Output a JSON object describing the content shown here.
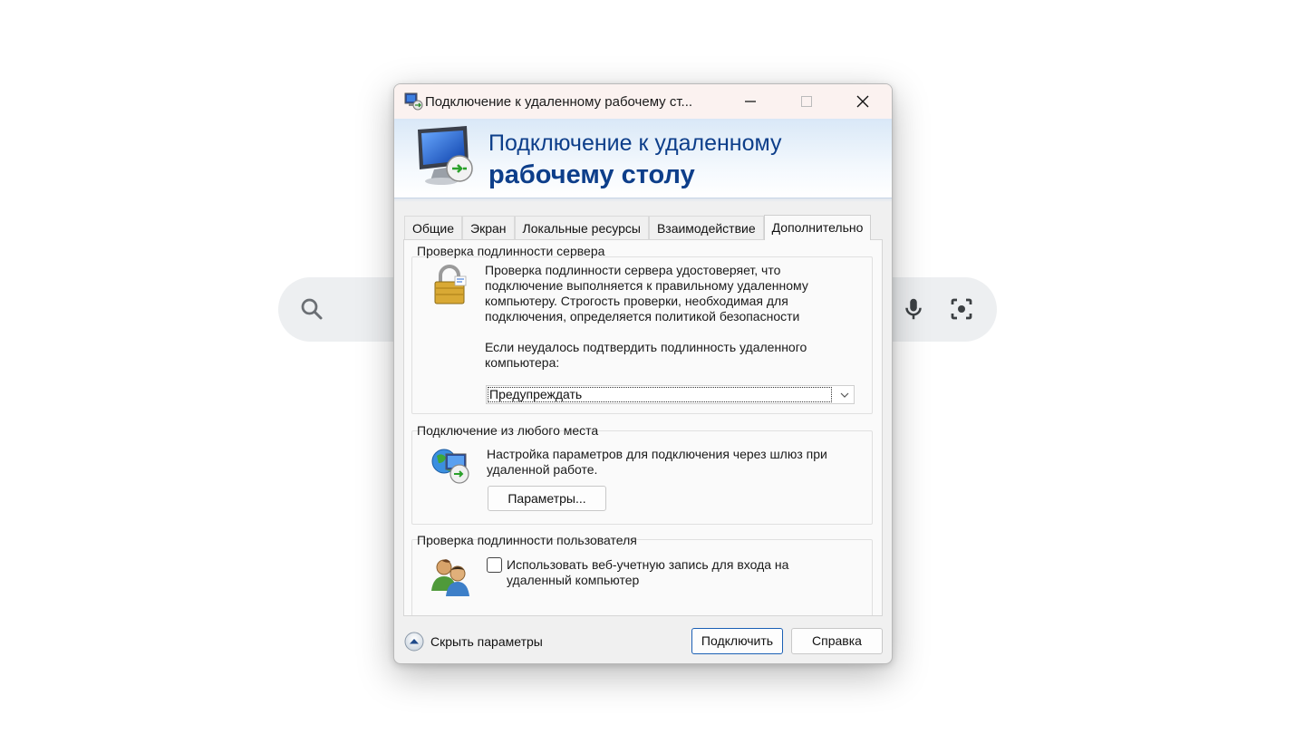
{
  "window": {
    "title": "Подключение к удаленному рабочему ст...",
    "banner_line1": "Подключение к удаленному",
    "banner_line2": "рабочему столу"
  },
  "tabs": [
    {
      "label": "Общие"
    },
    {
      "label": "Экран"
    },
    {
      "label": "Локальные ресурсы"
    },
    {
      "label": "Взаимодействие"
    },
    {
      "label": "Дополнительно",
      "active": true
    }
  ],
  "server_auth": {
    "title": "Проверка подлинности сервера",
    "description": [
      "Проверка подлинности сервера удостоверяет, что",
      "подключение выполняется к правильному удаленному",
      "компьютеру. Строгость проверки, необходимая для",
      "подключения, определяется политикой безопасности"
    ],
    "prompt": [
      "Если неудалось подтвердить подлинность удаленного",
      "компьютера:"
    ],
    "selected_option": "Предупреждать"
  },
  "gateway": {
    "title": "Подключение из любого места",
    "description": [
      "Настройка параметров для подключения через шлюз при",
      "удаленной работе."
    ],
    "settings_button": "Параметры..."
  },
  "user_auth": {
    "title": "Проверка подлинности пользователя",
    "checkbox_label": [
      "Использовать веб-учетную запись для входа на",
      "удаленный компьютер"
    ],
    "checked": false
  },
  "footer": {
    "hide_options": "Скрыть параметры",
    "connect_button": "Подключить",
    "help_button": "Справка"
  },
  "icons": [
    "search-icon",
    "microphone-icon",
    "camera-lens-icon",
    "remote-desktop-icon",
    "minimize-icon",
    "maximize-icon",
    "close-icon",
    "padlock-icon",
    "globe-computer-icon",
    "users-icon",
    "chevron-down-icon",
    "collapse-arrow-icon"
  ],
  "colors": {
    "banner_text": "#0d3e8a",
    "titlebar": "#fbf2f0",
    "primary_border": "#1a5fb4"
  }
}
